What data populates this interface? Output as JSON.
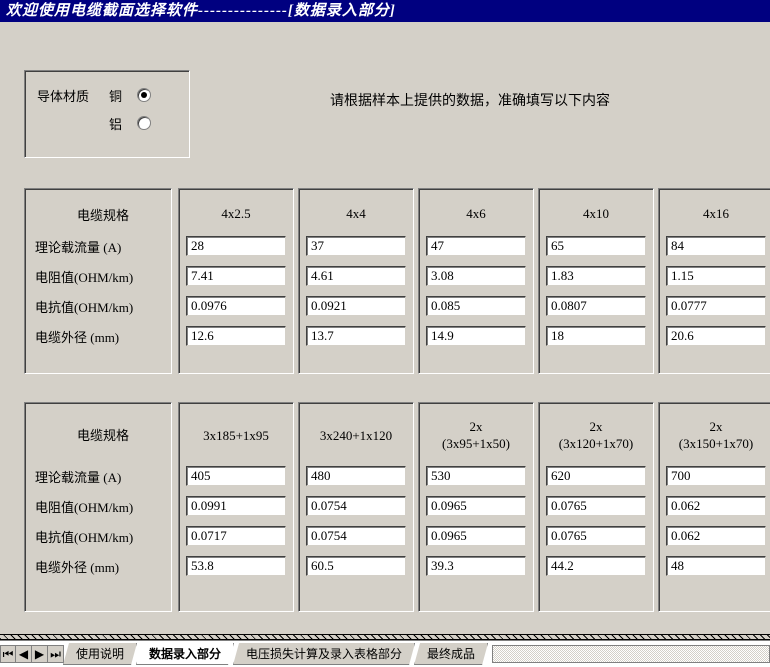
{
  "titlebar": "欢迎使用电缆截面选择软件---------------[数据录入部分]",
  "material": {
    "label": "导体材质",
    "options": [
      {
        "label": "铜",
        "checked": true
      },
      {
        "label": "铝",
        "checked": false
      }
    ]
  },
  "instruction": "请根据样本上提供的数据，准确填写以下内容",
  "row_labels": {
    "spec": "电缆规格",
    "capacity": "理论载流量  (A)",
    "resistance": "电阻值(OHM/km)",
    "reactance": "电抗值(OHM/km)",
    "diameter": "电缆外径   (mm)"
  },
  "grid1": {
    "cols": [
      {
        "spec": "4x2.5",
        "capacity": "28",
        "resistance": "7.41",
        "reactance": "0.0976",
        "diameter": "12.6"
      },
      {
        "spec": "4x4",
        "capacity": "37",
        "resistance": "4.61",
        "reactance": "0.0921",
        "diameter": "13.7"
      },
      {
        "spec": "4x6",
        "capacity": "47",
        "resistance": "3.08",
        "reactance": "0.085",
        "diameter": "14.9"
      },
      {
        "spec": "4x10",
        "capacity": "65",
        "resistance": "1.83",
        "reactance": "0.0807",
        "diameter": "18"
      },
      {
        "spec": "4x16",
        "capacity": "84",
        "resistance": "1.15",
        "reactance": "0.0777",
        "diameter": "20.6"
      }
    ]
  },
  "grid2": {
    "cols": [
      {
        "spec_l1": "",
        "spec_l2": "3x185+1x95",
        "capacity": "405",
        "resistance": "0.0991",
        "reactance": "0.0717",
        "diameter": "53.8"
      },
      {
        "spec_l1": "",
        "spec_l2": "3x240+1x120",
        "capacity": "480",
        "resistance": "0.0754",
        "reactance": "0.0754",
        "diameter": "60.5"
      },
      {
        "spec_l1": "2x",
        "spec_l2": "(3x95+1x50)",
        "capacity": "530",
        "resistance": "0.0965",
        "reactance": "0.0965",
        "diameter": "39.3"
      },
      {
        "spec_l1": "2x",
        "spec_l2": "(3x120+1x70)",
        "capacity": "620",
        "resistance": "0.0765",
        "reactance": "0.0765",
        "diameter": "44.2"
      },
      {
        "spec_l1": "2x",
        "spec_l2": "(3x150+1x70)",
        "capacity": "700",
        "resistance": "0.062",
        "reactance": "0.062",
        "diameter": "48"
      }
    ]
  },
  "tabs": {
    "nav": {
      "first": "⏮",
      "prev": "◀",
      "next": "▶",
      "last": "⏭"
    },
    "items": [
      {
        "label": "使用说明",
        "active": false
      },
      {
        "label": "数据录入部分",
        "active": true
      },
      {
        "label": "电压损失计算及录入表格部分",
        "active": false
      },
      {
        "label": "最终成品",
        "active": false
      }
    ]
  }
}
